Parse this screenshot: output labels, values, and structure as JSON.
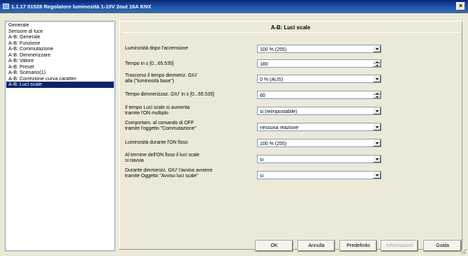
{
  "window": {
    "title": "1.1.17 01528 Regolatore luminosità 1-10V 2out 16A KNX",
    "close_glyph": "×"
  },
  "nav": {
    "items": [
      {
        "label": "Generale"
      },
      {
        "label": "Sensore di luce"
      },
      {
        "label": "A-B: Generale"
      },
      {
        "label": "A-B: Funzione"
      },
      {
        "label": "A-B: Commutazione"
      },
      {
        "label": "A-B: Dimmerizzare"
      },
      {
        "label": "A-B: Valore"
      },
      {
        "label": "A-B: Preset"
      },
      {
        "label": "A-B: Scenario(1)"
      },
      {
        "label": "A-B: Correzione curva caratter."
      },
      {
        "label": "A-B: Luci scale"
      }
    ],
    "selected_index": 10
  },
  "panel": {
    "title": "A-B: Luci scale",
    "params": [
      {
        "label_lines": [
          "Luminosità dopo l'accensione"
        ],
        "control": "dropdown",
        "value": "100 % (255)"
      },
      {
        "label_lines": [
          "Tempo in s [0...65.535]"
        ],
        "control": "spin",
        "value": "180"
      },
      {
        "label_lines": [
          "Trascorso il tempo dimmeriz. GIU'",
          "alla (\"luminosità base\")"
        ],
        "control": "dropdown",
        "value": "0 %     (AUS)"
      },
      {
        "label_lines": [
          "Tempo dimmerizzaz. GIU' in s [0...65.535]"
        ],
        "control": "spin",
        "value": "60"
      },
      {
        "label_lines": [
          "Il tempo Luci scale si aumenta",
          "tramite l'ON multiplo"
        ],
        "control": "dropdown",
        "value": "si (reimpostabile)"
      },
      {
        "label_lines": [
          "Comportam. al comando di OFF",
          "tramite l'oggetto \"Commutazione\""
        ],
        "control": "dropdown",
        "value": "nessuna reazione"
      },
      {
        "label_lines": [
          "Luminosità durante l'ON fisso"
        ],
        "control": "dropdown",
        "value": "100 % (255)"
      },
      {
        "label_lines": [
          "Al termine dell'ON fisso il luci scale",
          "si riavvia"
        ],
        "control": "dropdown",
        "value": "si"
      },
      {
        "label_lines": [
          "Durante dimmerizz. GIU' l'avviso avviene",
          "tramite Oggetto \"Avviso luci scale\""
        ],
        "control": "dropdown",
        "value": "si"
      }
    ]
  },
  "buttons": {
    "ok": "OK",
    "cancel": "Annulla",
    "default": "Predefinito",
    "info": "Informazioni",
    "help": "Guida"
  },
  "icons": {
    "window": "window-icon",
    "close": "close-icon",
    "dropdown": "chevron-down-icon",
    "spin_up": "spin-up-icon",
    "spin_down": "spin-down-icon",
    "resize": "resize-grip-icon"
  },
  "colors": {
    "titlebar": "#0a246a",
    "selection": "#0a246a",
    "face": "#ece9d8",
    "field_border": "#7f9db9"
  }
}
